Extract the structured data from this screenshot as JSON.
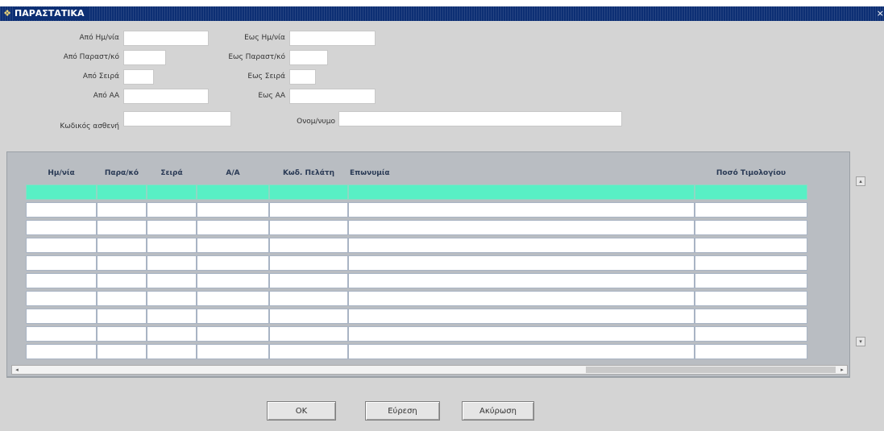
{
  "window": {
    "title": "ΠΑΡΑΣΤΑΤΙΚΑ",
    "close_glyph": "×",
    "icon": "app-icon"
  },
  "form": {
    "from_date_label": "Από Ημ/νία",
    "to_date_label": "Εως Ημ/νία",
    "from_doc_label": "Από Παραστ/κό",
    "to_doc_label": "Εως Παραστ/κό",
    "from_series_label": "Από Σειρά",
    "to_series_label": "Εως Σειρά",
    "from_aa_label": "Από ΑΑ",
    "to_aa_label": "Εως ΑΑ",
    "patient_code_label": "Κωδικός ασθενή",
    "surname_label": "Ονομ/νυμο",
    "from_date_value": "",
    "to_date_value": "",
    "from_doc_value": "",
    "to_doc_value": "",
    "from_series_value": "",
    "to_series_value": "",
    "from_aa_value": "",
    "to_aa_value": "",
    "patient_code_value": "",
    "surname_value": ""
  },
  "grid": {
    "columns": [
      "Ημ/νία",
      "Παρα/κό",
      "Σειρά",
      "Α/Α",
      "Κωδ. Πελάτη",
      "Επωνυμία",
      "Ποσό Τιμολογίου"
    ],
    "rows": [
      [
        "",
        "",
        "",
        "",
        "",
        "",
        ""
      ],
      [
        "",
        "",
        "",
        "",
        "",
        "",
        ""
      ],
      [
        "",
        "",
        "",
        "",
        "",
        "",
        ""
      ],
      [
        "",
        "",
        "",
        "",
        "",
        "",
        ""
      ],
      [
        "",
        "",
        "",
        "",
        "",
        "",
        ""
      ],
      [
        "",
        "",
        "",
        "",
        "",
        "",
        ""
      ],
      [
        "",
        "",
        "",
        "",
        "",
        "",
        ""
      ],
      [
        "",
        "",
        "",
        "",
        "",
        "",
        ""
      ],
      [
        "",
        "",
        "",
        "",
        "",
        "",
        ""
      ],
      [
        "",
        "",
        "",
        "",
        "",
        "",
        ""
      ]
    ],
    "active_row_color": "#58f0c5"
  },
  "buttons": {
    "ok": "OK",
    "search": "Εύρεση",
    "cancel": "Ακύρωση"
  },
  "colors": {
    "titlebar": "#0d2f74",
    "background": "#d4d4d4",
    "grid_frame": "#b9bdc2"
  }
}
